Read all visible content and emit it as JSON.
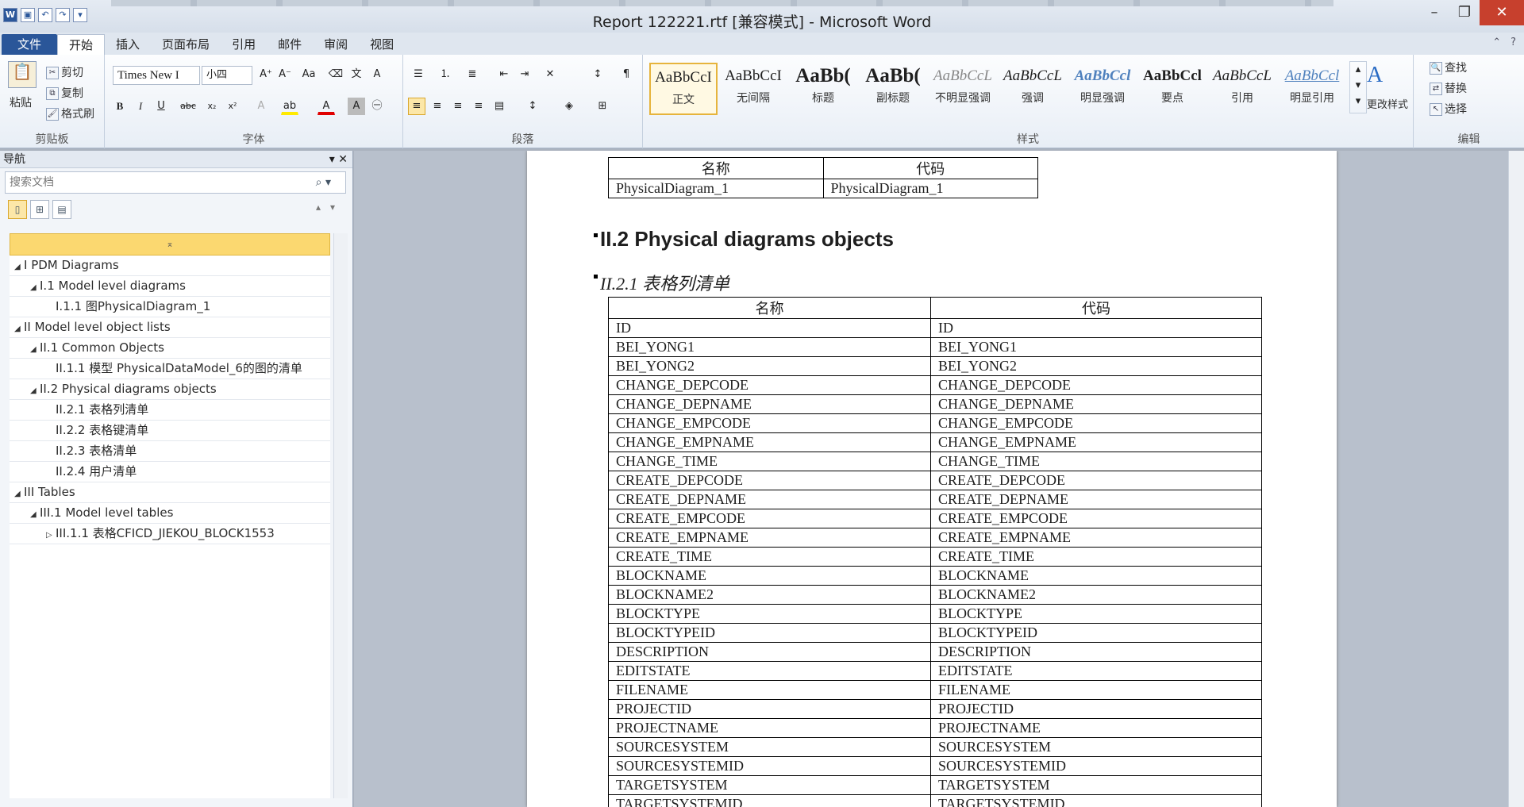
{
  "window": {
    "title": "Report 122221.rtf [兼容模式] - Microsoft Word",
    "minimize": "–",
    "restore": "❐",
    "close": "✕"
  },
  "ribbon": {
    "tabs": [
      "文件",
      "开始",
      "插入",
      "页面布局",
      "引用",
      "邮件",
      "审阅",
      "视图"
    ],
    "active_tab": "开始",
    "clipboard": {
      "group_label": "剪贴板",
      "paste": "粘贴",
      "cut": "剪切",
      "copy": "复制",
      "format_painter": "格式刷"
    },
    "font": {
      "group_label": "字体",
      "font_name": "Times New I",
      "font_size": "小四"
    },
    "paragraph": {
      "group_label": "段落"
    },
    "styles": {
      "group_label": "样式",
      "items": [
        {
          "sample": "AaBbCcI",
          "name": "正文"
        },
        {
          "sample": "AaBbCcI",
          "name": "无间隔"
        },
        {
          "sample": "AaBb(",
          "name": "标题"
        },
        {
          "sample": "AaBb(",
          "name": "副标题"
        },
        {
          "sample": "AaBbCcL",
          "name": "不明显强调"
        },
        {
          "sample": "AaBbCcL",
          "name": "强调"
        },
        {
          "sample": "AaBbCcl",
          "name": "明显强调"
        },
        {
          "sample": "AaBbCcl",
          "name": "要点"
        },
        {
          "sample": "AaBbCcL",
          "name": "引用"
        },
        {
          "sample": "AaBbCcl",
          "name": "明显引用"
        }
      ],
      "change_styles": "更改样式"
    },
    "editing": {
      "group_label": "编辑",
      "find": "查找",
      "replace": "替换",
      "select": "选择"
    }
  },
  "nav": {
    "title": "导航",
    "search_placeholder": "搜索文档",
    "tree": [
      {
        "label": "I PDM Diagrams",
        "level": 0,
        "toggle": "◢"
      },
      {
        "label": "I.1 Model level diagrams",
        "level": 1,
        "toggle": "◢"
      },
      {
        "label": "I.1.1 图PhysicalDiagram_1",
        "level": 2,
        "toggle": ""
      },
      {
        "label": "II Model level object lists",
        "level": 0,
        "toggle": "◢"
      },
      {
        "label": "II.1 Common Objects",
        "level": 1,
        "toggle": "◢"
      },
      {
        "label": "II.1.1 模型  PhysicalDataModel_6的图的清单",
        "level": 2,
        "toggle": ""
      },
      {
        "label": "II.2 Physical diagrams objects",
        "level": 1,
        "toggle": "◢"
      },
      {
        "label": "II.2.1 表格列清单",
        "level": 2,
        "toggle": ""
      },
      {
        "label": "II.2.2 表格键清单",
        "level": 2,
        "toggle": ""
      },
      {
        "label": "II.2.3 表格清单",
        "level": 2,
        "toggle": ""
      },
      {
        "label": "II.2.4 用户清单",
        "level": 2,
        "toggle": ""
      },
      {
        "label": "III Tables",
        "level": 0,
        "toggle": "◢"
      },
      {
        "label": "III.1 Model level tables",
        "level": 1,
        "toggle": "◢"
      },
      {
        "label": "III.1.1 表格CFICD_JIEKOU_BLOCK1553",
        "level": 2,
        "toggle": "▷"
      }
    ]
  },
  "document": {
    "top_table": {
      "headers": [
        "名称",
        "代码"
      ],
      "rows": [
        [
          "PhysicalDiagram_1",
          "PhysicalDiagram_1"
        ]
      ]
    },
    "heading2": "II.2 Physical diagrams objects",
    "heading3": "II.2.1 表格列清单",
    "column_table": {
      "headers": [
        "名称",
        "代码"
      ],
      "rows": [
        [
          "ID",
          "ID"
        ],
        [
          "BEI_YONG1",
          "BEI_YONG1"
        ],
        [
          "BEI_YONG2",
          "BEI_YONG2"
        ],
        [
          "CHANGE_DEPCODE",
          "CHANGE_DEPCODE"
        ],
        [
          "CHANGE_DEPNAME",
          "CHANGE_DEPNAME"
        ],
        [
          "CHANGE_EMPCODE",
          "CHANGE_EMPCODE"
        ],
        [
          "CHANGE_EMPNAME",
          "CHANGE_EMPNAME"
        ],
        [
          "CHANGE_TIME",
          "CHANGE_TIME"
        ],
        [
          "CREATE_DEPCODE",
          "CREATE_DEPCODE"
        ],
        [
          "CREATE_DEPNAME",
          "CREATE_DEPNAME"
        ],
        [
          "CREATE_EMPCODE",
          "CREATE_EMPCODE"
        ],
        [
          "CREATE_EMPNAME",
          "CREATE_EMPNAME"
        ],
        [
          "CREATE_TIME",
          "CREATE_TIME"
        ],
        [
          "BLOCKNAME",
          "BLOCKNAME"
        ],
        [
          "BLOCKNAME2",
          "BLOCKNAME2"
        ],
        [
          "BLOCKTYPE",
          "BLOCKTYPE"
        ],
        [
          "BLOCKTYPEID",
          "BLOCKTYPEID"
        ],
        [
          "DESCRIPTION",
          "DESCRIPTION"
        ],
        [
          "EDITSTATE",
          "EDITSTATE"
        ],
        [
          "FILENAME",
          "FILENAME"
        ],
        [
          "PROJECTID",
          "PROJECTID"
        ],
        [
          "PROJECTNAME",
          "PROJECTNAME"
        ],
        [
          "SOURCESYSTEM",
          "SOURCESYSTEM"
        ],
        [
          "SOURCESYSTEMID",
          "SOURCESYSTEMID"
        ],
        [
          "TARGETSYSTEM",
          "TARGETSYSTEM"
        ],
        [
          "TARGETSYSTEMID",
          "TARGETSYSTEMID"
        ]
      ]
    }
  }
}
